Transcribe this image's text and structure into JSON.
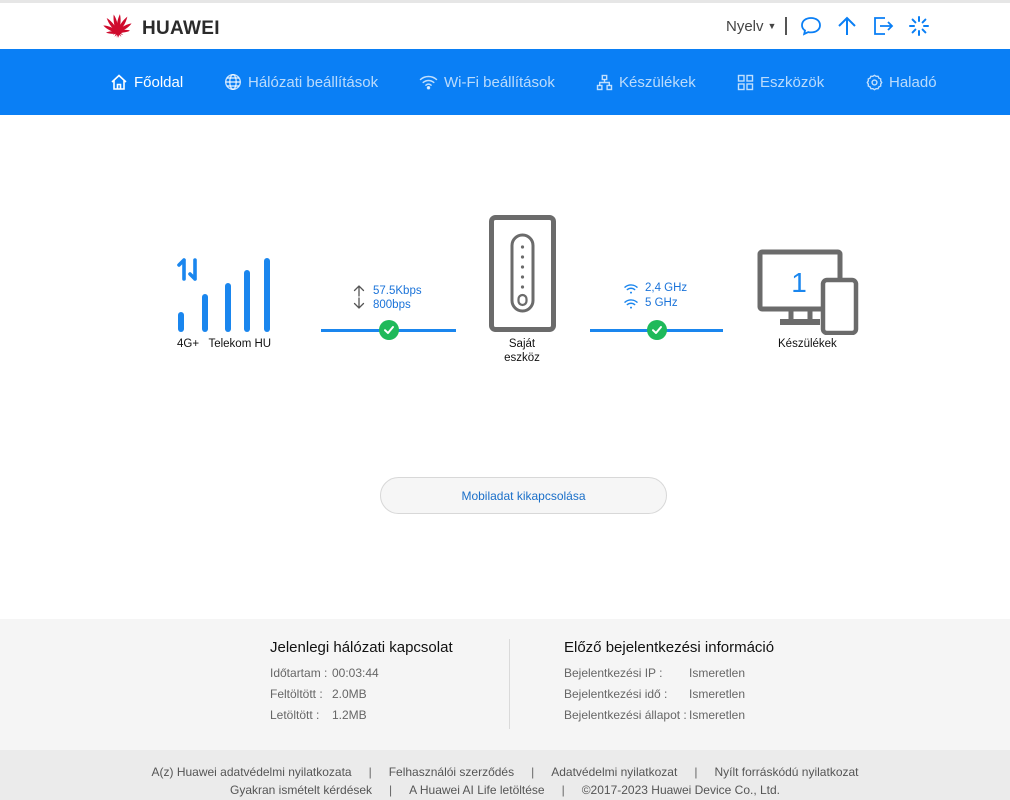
{
  "header": {
    "brand": "HUAWEI",
    "language_label": "Nyelv",
    "icons": [
      "chat-icon",
      "upload-icon",
      "logout-icon",
      "loading-icon"
    ]
  },
  "nav": {
    "items": [
      {
        "label": "Főoldal",
        "icon": "home-icon",
        "active": true
      },
      {
        "label": "Hálózati beállítások",
        "icon": "globe-icon",
        "active": false
      },
      {
        "label": "Wi-Fi beállítások",
        "icon": "wifi-icon",
        "active": false
      },
      {
        "label": "Készülékek",
        "icon": "devices-icon",
        "active": false
      },
      {
        "label": "Eszközök",
        "icon": "tools-icon",
        "active": false
      },
      {
        "label": "Haladó",
        "icon": "gear-icon",
        "active": false
      }
    ]
  },
  "status": {
    "network_type": "4G+",
    "operator": "Telekom HU",
    "upload_speed": "57.5Kbps",
    "download_speed": "800bps",
    "router_label_line1": "Saját",
    "router_label_line2": "eszköz",
    "band_24": "2,4 GHz",
    "band_5": "5 GHz",
    "device_count": "1",
    "devices_label": "Készülékek"
  },
  "actions": {
    "mobile_data_button": "Mobiladat kikapcsolása"
  },
  "current_connection": {
    "title": "Jelenlegi hálózati kapcsolat",
    "rows": [
      {
        "key": "Időtartam :",
        "value": "00:03:44"
      },
      {
        "key": "Feltöltött :",
        "value": "2.0MB"
      },
      {
        "key": "Letöltött :",
        "value": "1.2MB"
      }
    ]
  },
  "last_login": {
    "title": "Előző bejelentkezési információ",
    "rows": [
      {
        "key": "Bejelentkezési IP :",
        "value": "Ismeretlen"
      },
      {
        "key": "Bejelentkezési idő :",
        "value": "Ismeretlen"
      },
      {
        "key": "Bejelentkezési állapot :",
        "value": "Ismeretlen"
      }
    ]
  },
  "footer": {
    "row1": [
      "A(z) Huawei adatvédelmi nyilatkozata",
      "Felhasználói szerződés",
      "Adatvédelmi nyilatkozat",
      "Nyílt forráskódú nyilatkozat"
    ],
    "row2": [
      "Gyakran ismételt kérdések",
      "A Huawei AI Life letöltése"
    ],
    "copyright": "©2017-2023 Huawei Device Co., Ltd."
  },
  "colors": {
    "nav_bg": "#0a7ff5",
    "accent_blue": "#1a86ee",
    "ok_green": "#1fb95a",
    "brand_red": "#cf0a2c"
  }
}
